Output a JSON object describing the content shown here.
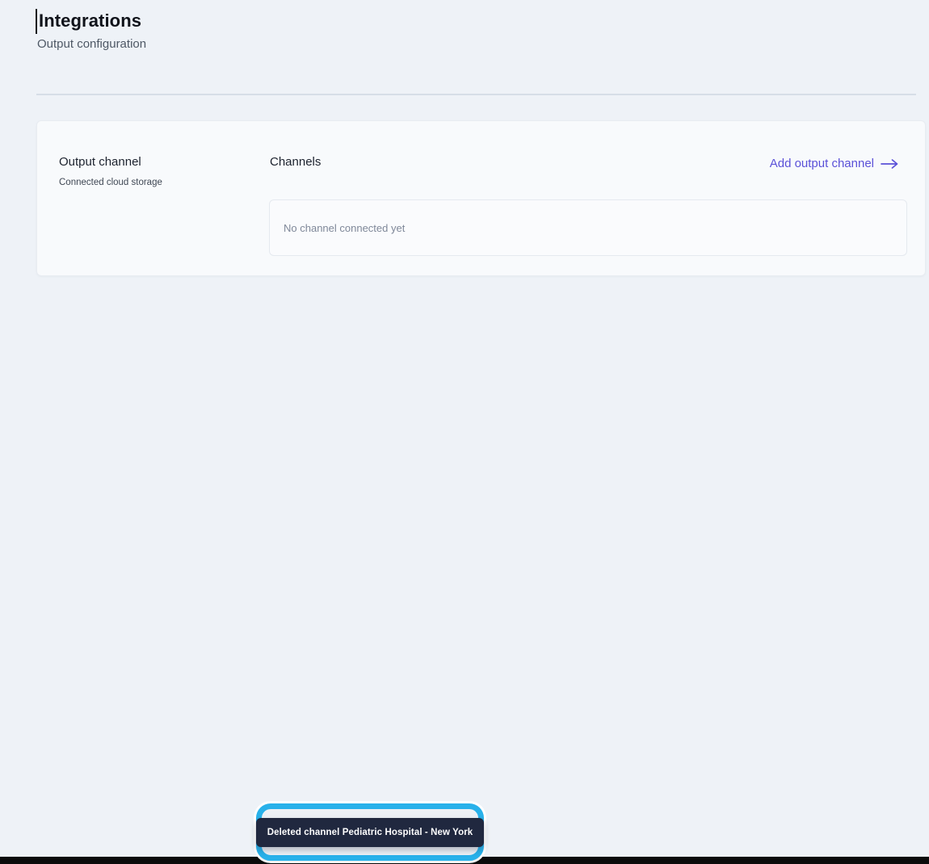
{
  "page": {
    "title": "Integrations",
    "subtitle": "Output configuration"
  },
  "card": {
    "section_title": "Output channel",
    "section_subtitle": "Connected cloud storage",
    "channels_label": "Channels",
    "add_link_label": "Add output channel",
    "empty_state": "No channel connected yet"
  },
  "toast": {
    "message": "Deleted channel Pediatric Hospital - New York"
  },
  "colors": {
    "accent_purple": "#5b51d8",
    "annotation_cyan": "#28b1ea",
    "toast_bg": "#20283f",
    "page_bg": "#eef2f7",
    "card_bg": "#f8fafc"
  }
}
